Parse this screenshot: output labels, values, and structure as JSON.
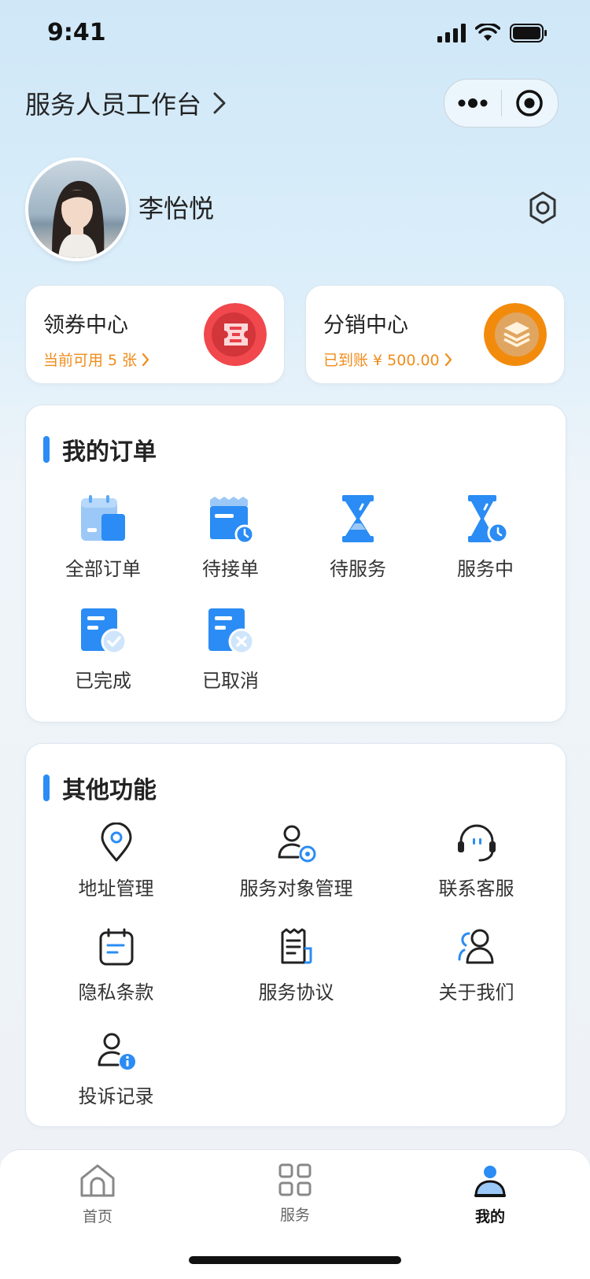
{
  "status_bar": {
    "time": "9:41"
  },
  "header": {
    "title": "服务人员工作台"
  },
  "profile": {
    "name": "李怡悦"
  },
  "coupon_card": {
    "title": "领券中心",
    "subtitle": "当前可用 5 张"
  },
  "distribution_card": {
    "title": "分销中心",
    "subtitle": "已到账 ¥ 500.00"
  },
  "orders": {
    "title": "我的订单",
    "items": [
      {
        "label": "全部订单",
        "icon": "all-orders-icon"
      },
      {
        "label": "待接单",
        "icon": "pending-accept-icon"
      },
      {
        "label": "待服务",
        "icon": "pending-service-icon"
      },
      {
        "label": "服务中",
        "icon": "in-service-icon"
      },
      {
        "label": "已完成",
        "icon": "completed-icon"
      },
      {
        "label": "已取消",
        "icon": "cancelled-icon"
      }
    ]
  },
  "functions": {
    "title": "其他功能",
    "items": [
      {
        "label": "地址管理",
        "icon": "location-icon"
      },
      {
        "label": "服务对象管理",
        "icon": "user-settings-icon"
      },
      {
        "label": "联系客服",
        "icon": "headset-icon"
      },
      {
        "label": "隐私条款",
        "icon": "calendar-doc-icon"
      },
      {
        "label": "服务协议",
        "icon": "agreement-icon"
      },
      {
        "label": "关于我们",
        "icon": "users-icon"
      },
      {
        "label": "投诉记录",
        "icon": "user-info-icon"
      }
    ]
  },
  "tabbar": {
    "items": [
      {
        "label": "首页",
        "icon": "home-icon"
      },
      {
        "label": "服务",
        "icon": "grid-icon"
      },
      {
        "label": "我的",
        "icon": "profile-icon",
        "active": true
      }
    ]
  },
  "colors": {
    "accent": "#2a8cf4",
    "orange": "#f08c1c",
    "coupon_red": "#f0484d"
  }
}
